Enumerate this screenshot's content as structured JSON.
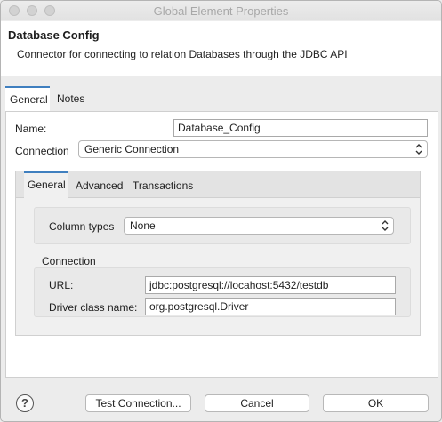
{
  "window": {
    "title": "Global Element Properties"
  },
  "header": {
    "title": "Database Config",
    "description": "Connector for connecting to relation Databases through the JDBC API"
  },
  "outer_tabs": [
    {
      "label": "General",
      "active": true
    },
    {
      "label": "Notes",
      "active": false
    }
  ],
  "form": {
    "name_label": "Name:",
    "name_value": "Database_Config",
    "connection_label": "Connection",
    "connection_value": "Generic Connection"
  },
  "inner_tabs": [
    {
      "label": "General",
      "active": true
    },
    {
      "label": "Advanced",
      "active": false
    },
    {
      "label": "Transactions",
      "active": false
    }
  ],
  "column_types": {
    "label": "Column types",
    "value": "None"
  },
  "connection_group": {
    "title": "Connection",
    "url_label": "URL:",
    "url_value": "jdbc:postgresql://locahost:5432/testdb",
    "driver_label": "Driver class name:",
    "driver_value": "org.postgresql.Driver"
  },
  "footer": {
    "help_glyph": "?",
    "test_connection": "Test Connection...",
    "cancel": "Cancel",
    "ok": "OK"
  },
  "colors": {
    "tab_accent": "#3f7fbf",
    "panel_bg": "#ffffff",
    "window_bg": "#ececec"
  }
}
